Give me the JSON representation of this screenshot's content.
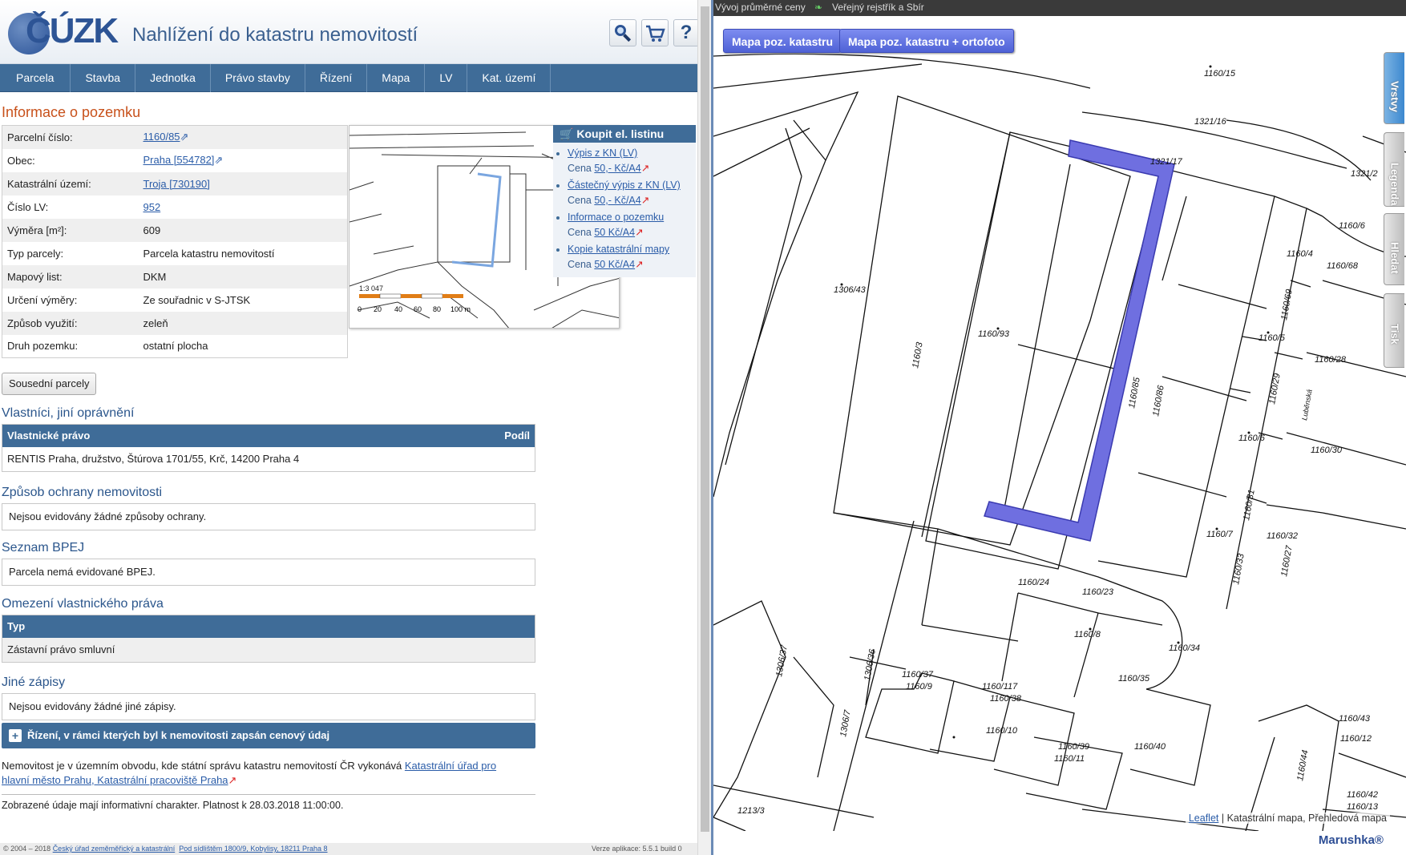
{
  "app": {
    "logo_text": "ČÚZK",
    "title": "Nahlížení do katastru nemovitostí",
    "search_btn": "search-icon",
    "cart_btn": "cart-icon",
    "help_btn": "?"
  },
  "menu": [
    "Parcela",
    "Stavba",
    "Jednotka",
    "Právo stavby",
    "Řízení",
    "Mapa",
    "LV",
    "Kat. území"
  ],
  "section_title": "Informace o pozemku",
  "info": [
    {
      "key": "Parcelní číslo:",
      "value": "1160/85",
      "link": true
    },
    {
      "key": "Obec:",
      "value": "Praha [554782]",
      "link": true
    },
    {
      "key": "Katastrální území:",
      "value": "Troja [730190]",
      "link": true
    },
    {
      "key": "Číslo LV:",
      "value": "952",
      "link": true
    },
    {
      "key": "Výměra [m²]:",
      "value": "609",
      "link": false
    },
    {
      "key": "Typ parcely:",
      "value": "Parcela katastru nemovitostí",
      "link": false
    },
    {
      "key": "Mapový list:",
      "value": "DKM",
      "link": false
    },
    {
      "key": "Určení výměry:",
      "value": "Ze souřadnic v S-JTSK",
      "link": false
    },
    {
      "key": "Způsob využití:",
      "value": "zeleň",
      "link": false
    },
    {
      "key": "Druh pozemku:",
      "value": "ostatní plocha",
      "link": false
    }
  ],
  "minimap": {
    "scale": "1:3 047",
    "ticks": [
      "0",
      "20",
      "40",
      "60",
      "80",
      "100 m"
    ]
  },
  "buy": {
    "title": "Koupit el. listinu",
    "items": [
      {
        "label": "Výpis z KN (LV)",
        "price_prefix": "Cena ",
        "price": "50,- Kč/A4"
      },
      {
        "label": "Částečný výpis z KN (LV)",
        "price_prefix": "Cena ",
        "price": "50,- Kč/A4"
      },
      {
        "label": "Informace o pozemku",
        "price_prefix": "Cena ",
        "price": "50 Kč/A4"
      },
      {
        "label": "Kopie katastrální mapy",
        "price_prefix": "Cena ",
        "price": "50 Kč/A4"
      }
    ]
  },
  "neighbours_btn": "Sousední parcely",
  "owners": {
    "title": "Vlastníci, jiní oprávnění",
    "col1": "Vlastnické právo",
    "col2": "Podíl",
    "row": "RENTIS Praha, družstvo, Štúrova 1701/55, Krč, 14200 Praha 4"
  },
  "protection": {
    "title": "Způsob ochrany nemovitosti",
    "text": "Nejsou evidovány žádné způsoby ochrany."
  },
  "bpej": {
    "title": "Seznam BPEJ",
    "text": "Parcela nemá evidované BPEJ."
  },
  "restrictions": {
    "title": "Omezení vlastnického práva",
    "col": "Typ",
    "row": "Zástavní právo smluvní"
  },
  "other": {
    "title": "Jiné zápisy",
    "text": "Nejsou evidovány žádné jiné zápisy."
  },
  "rizeni_bar": "Řízení, v rámci kterých byl k nemovitosti zapsán cenový údaj",
  "office": {
    "text": "Nemovitost je v územním obvodu, kde státní správu katastru nemovitostí ČR vykonává ",
    "link1": "Katastrální úřad pro",
    "link2": "hlavní město Prahu, Katastrální pracoviště Praha"
  },
  "validity": "Zobrazené údaje mají informativní charakter. Platnost k 28.03.2018 11:00:00.",
  "bottom": {
    "copyright_prefix": "© 2004 – 2018 ",
    "copyright_link": "Český úřad zeměměřický a katastrální",
    "address_link": "Pod sídlištěm 1800/9, Kobylisy, 18211 Praha 8",
    "version": "Verze aplikace: 5.5.1 build 0"
  },
  "right": {
    "tabs": [
      "Vývoj průměrné ceny",
      "Veřejný rejstřík a Sbír"
    ],
    "map_buttons": [
      "Mapa poz. katastru",
      "Mapa poz. katastru + ortofoto"
    ],
    "side_tabs": [
      "Vrstvy",
      "Legenda",
      "Hledat",
      "Tisk"
    ],
    "attribution_link": "Leaflet",
    "attribution_text": " | Katastrální mapa, Přehledová mapa",
    "brand": "Marushka®",
    "labels": [
      "1160/15",
      "1321/16",
      "1321/17",
      "1321/2",
      "1160/6",
      "1160/4",
      "1160/68",
      "1306/43",
      "1160/3",
      "1160/93",
      "1160/5",
      "1160/69",
      "1160/28",
      "1160/85",
      "1160/86",
      "1160/29",
      "Luběnská",
      "1160/6",
      "1160/30",
      "1160/31",
      "1160/7",
      "1160/32",
      "1160/33",
      "1160/27",
      "1160/24",
      "1160/23",
      "1160/8",
      "1160/34",
      "1306/37",
      "1306/36",
      "1160/37",
      "1160/9",
      "1160/117",
      "1160/38",
      "1160/35",
      "1160/10",
      "1160/39",
      "1160/11",
      "1160/40",
      "1160/43",
      "1160/12",
      "1160/44",
      "1160/42",
      "1160/13",
      "1213/3",
      "1306/7"
    ]
  },
  "colors": {
    "accent": "#3f6c98",
    "title_orange": "#c8511b",
    "highlight": "#6f6fe0"
  }
}
